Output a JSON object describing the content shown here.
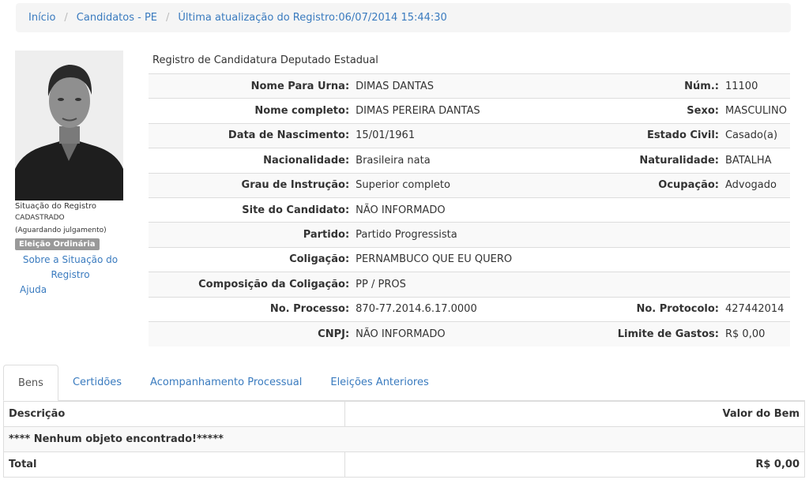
{
  "breadcrumb": {
    "home": "Início",
    "candidates": "Candidatos - PE",
    "update": "Última atualização do Registro:06/07/2014 15:44:30"
  },
  "sidebar": {
    "status_title": "Situação do Registro",
    "status_value": "CADASTRADO",
    "status_note": "(Aguardando julgamento)",
    "badge": "Eleição Ordinária",
    "about_link": "Sobre a Situação do Registro",
    "help_link": "Ajuda"
  },
  "registro": {
    "title": "Registro de Candidatura Deputado Estadual",
    "rows": [
      {
        "l1": "Nome Para Urna:",
        "v1": "DIMAS DANTAS",
        "l2": "Núm.:",
        "v2": "11100"
      },
      {
        "l1": "Nome completo:",
        "v1": "DIMAS PEREIRA DANTAS",
        "l2": "Sexo:",
        "v2": "MASCULINO"
      },
      {
        "l1": "Data de Nascimento:",
        "v1": "15/01/1961",
        "l2": "Estado Civil:",
        "v2": "Casado(a)"
      },
      {
        "l1": "Nacionalidade:",
        "v1": "Brasileira nata",
        "l2": "Naturalidade:",
        "v2": "BATALHA"
      },
      {
        "l1": "Grau de Instrução:",
        "v1": "Superior completo",
        "l2": "Ocupação:",
        "v2": "Advogado"
      },
      {
        "l1": "Site do Candidato:",
        "v1": "NÃO INFORMADO",
        "l2": "",
        "v2": ""
      },
      {
        "l1": "Partido:",
        "v1": "Partido Progressista",
        "l2": "",
        "v2": ""
      },
      {
        "l1": "Coligação:",
        "v1": "PERNAMBUCO QUE EU QUERO",
        "l2": "",
        "v2": ""
      },
      {
        "l1": "Composição da Coligação:",
        "v1": "PP / PROS",
        "l2": "",
        "v2": ""
      },
      {
        "l1": "No. Processo:",
        "v1": "870-77.2014.6.17.0000",
        "l2": "No. Protocolo:",
        "v2": "427442014"
      },
      {
        "l1": "CNPJ:",
        "v1": "NÃO INFORMADO",
        "l2": "Limite de Gastos:",
        "v2": "R$ 0,00"
      }
    ]
  },
  "tabs": [
    "Bens",
    "Certidões",
    "Acompanhamento Processual",
    "Eleições Anteriores"
  ],
  "bens": {
    "col_desc": "Descrição",
    "col_valor": "Valor do Bem",
    "empty": "**** Nenhum objeto encontrado!*****",
    "total_label": "Total",
    "total_value": "R$ 0,00"
  }
}
